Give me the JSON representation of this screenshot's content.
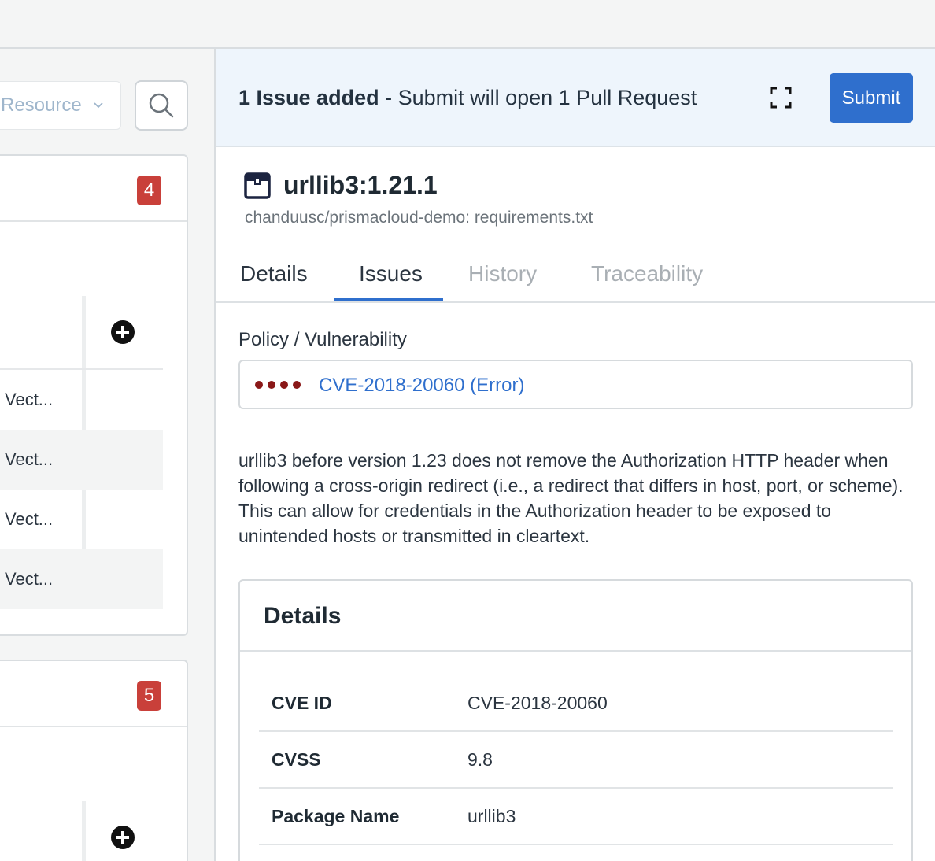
{
  "left_panel": {
    "filter": {
      "label": "Resource"
    },
    "cards": [
      {
        "badge": "4",
        "rows": [
          "Vect...",
          "Vect...",
          "Vect...",
          "Vect..."
        ]
      },
      {
        "badge": "5"
      }
    ]
  },
  "banner": {
    "count_text": "1 Issue added",
    "rest_text": " - Submit will open 1 Pull Request",
    "submit_label": "Submit"
  },
  "package": {
    "title": "urllib3:1.21.1",
    "subtitle": "chanduusc/prismacloud-demo: requirements.txt"
  },
  "tabs": [
    {
      "label": "Details",
      "state": "normal"
    },
    {
      "label": "Issues",
      "state": "active"
    },
    {
      "label": "History",
      "state": "disabled"
    },
    {
      "label": "Traceability",
      "state": "disabled"
    }
  ],
  "policy": {
    "label": "Policy / Vulnerability",
    "severity_dots": 4,
    "severity_color": "#8a1818",
    "link": "CVE-2018-20060 (Error)"
  },
  "description": "urllib3 before version 1.23 does not remove the Authorization HTTP header when following a cross-origin redirect (i.e., a redirect that differs in host, port, or scheme). This can allow for credentials in the Authorization header to be exposed to unintended hosts or transmitted in cleartext.",
  "details": {
    "title": "Details",
    "rows": [
      {
        "key": "CVE ID",
        "value": "CVE-2018-20060"
      },
      {
        "key": "CVSS",
        "value": "9.8"
      },
      {
        "key": "Package Name",
        "value": "urllib3"
      }
    ]
  },
  "colors": {
    "accent": "#2f6fcd",
    "badge": "#c9403a",
    "banner_bg": "#eef5fc"
  }
}
